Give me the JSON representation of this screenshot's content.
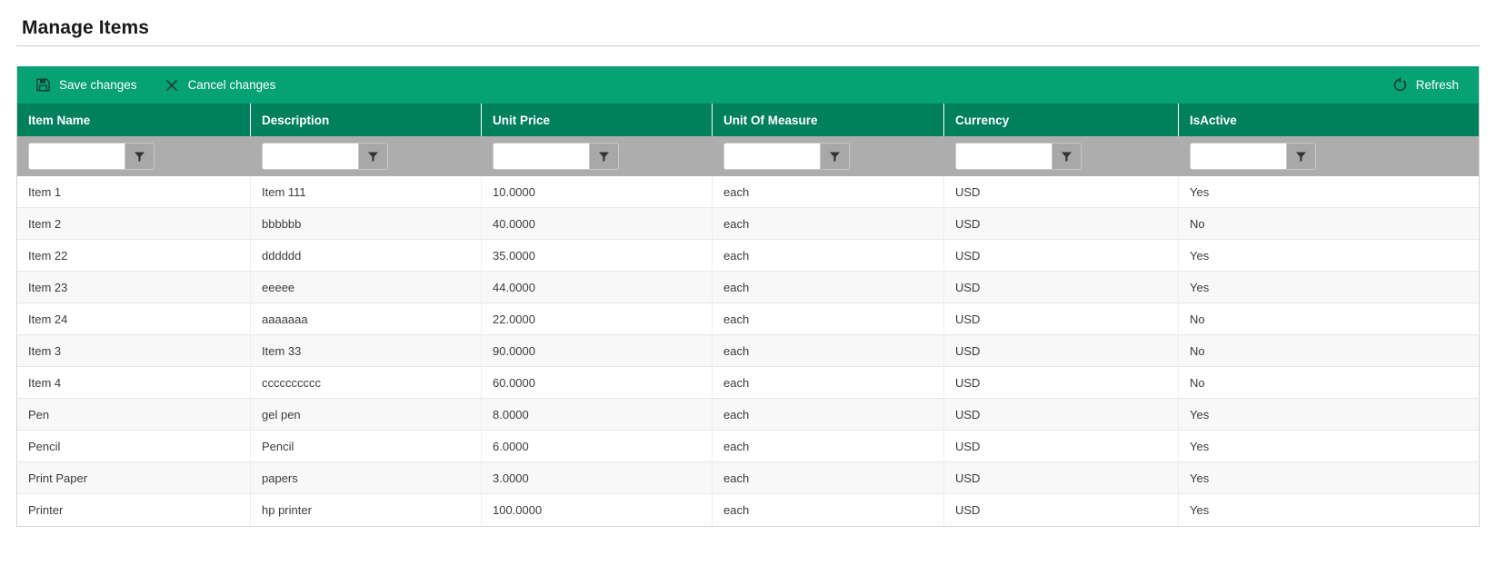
{
  "page": {
    "title": "Manage Items"
  },
  "toolbar": {
    "save_label": "Save changes",
    "cancel_label": "Cancel changes",
    "refresh_label": "Refresh",
    "accent_color": "#06a175",
    "header_color": "#00805c"
  },
  "grid": {
    "columns": [
      {
        "key": "item_name",
        "label": "Item Name"
      },
      {
        "key": "description",
        "label": "Description"
      },
      {
        "key": "unit_price",
        "label": "Unit Price"
      },
      {
        "key": "unit_of_measure",
        "label": "Unit Of Measure"
      },
      {
        "key": "currency",
        "label": "Currency"
      },
      {
        "key": "is_active",
        "label": "IsActive"
      }
    ],
    "filters": [
      {
        "value": "",
        "placeholder": ""
      },
      {
        "value": "",
        "placeholder": ""
      },
      {
        "value": "",
        "placeholder": ""
      },
      {
        "value": "",
        "placeholder": ""
      },
      {
        "value": "",
        "placeholder": ""
      },
      {
        "value": "",
        "placeholder": ""
      }
    ],
    "rows": [
      {
        "item_name": "Item 1",
        "description": "Item 111",
        "unit_price": "10.0000",
        "unit_of_measure": "each",
        "currency": "USD",
        "is_active": "Yes"
      },
      {
        "item_name": "Item 2",
        "description": "bbbbbb",
        "unit_price": "40.0000",
        "unit_of_measure": "each",
        "currency": "USD",
        "is_active": "No"
      },
      {
        "item_name": "Item 22",
        "description": "dddddd",
        "unit_price": "35.0000",
        "unit_of_measure": "each",
        "currency": "USD",
        "is_active": "Yes"
      },
      {
        "item_name": "Item 23",
        "description": "eeeee",
        "unit_price": "44.0000",
        "unit_of_measure": "each",
        "currency": "USD",
        "is_active": "Yes"
      },
      {
        "item_name": "Item 24",
        "description": "aaaaaaa",
        "unit_price": "22.0000",
        "unit_of_measure": "each",
        "currency": "USD",
        "is_active": "No"
      },
      {
        "item_name": "Item 3",
        "description": "Item 33",
        "unit_price": "90.0000",
        "unit_of_measure": "each",
        "currency": "USD",
        "is_active": "No"
      },
      {
        "item_name": "Item 4",
        "description": "cccccccccc",
        "unit_price": "60.0000",
        "unit_of_measure": "each",
        "currency": "USD",
        "is_active": "No"
      },
      {
        "item_name": "Pen",
        "description": "gel pen",
        "unit_price": "8.0000",
        "unit_of_measure": "each",
        "currency": "USD",
        "is_active": "Yes"
      },
      {
        "item_name": "Pencil",
        "description": "Pencil",
        "unit_price": "6.0000",
        "unit_of_measure": "each",
        "currency": "USD",
        "is_active": "Yes"
      },
      {
        "item_name": "Print Paper",
        "description": "papers",
        "unit_price": "3.0000",
        "unit_of_measure": "each",
        "currency": "USD",
        "is_active": "Yes"
      },
      {
        "item_name": "Printer",
        "description": "hp printer",
        "unit_price": "100.0000",
        "unit_of_measure": "each",
        "currency": "USD",
        "is_active": "Yes"
      }
    ]
  },
  "icons": {
    "save": "floppy-disk-icon",
    "cancel": "x-icon",
    "refresh": "refresh-circular-arrow-icon",
    "filter": "funnel-icon"
  }
}
